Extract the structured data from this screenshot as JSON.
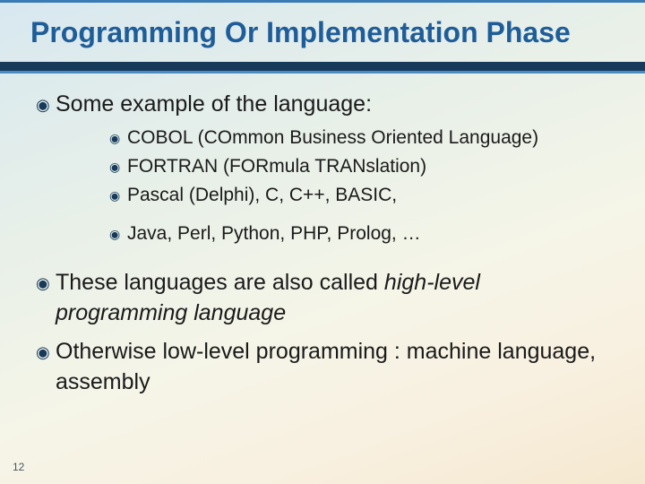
{
  "slide": {
    "title": "Programming Or Implementation Phase",
    "page_number": "12",
    "bullet_glyph_lvl1": "◉",
    "bullet_glyph_lvl2": "◉",
    "points": [
      {
        "text": "Some example of the language:",
        "sub": [
          "COBOL (COmmon Business Oriented Language)",
          "FORTRAN (FORmula TRANslation)",
          "Pascal (Delphi),  C,  C++, BASIC,"
        ],
        "sub_after_gap": [
          "Java, Perl, Python, PHP, Prolog, …"
        ]
      },
      {
        "text_pre": "These languages are also called ",
        "text_italic": "high-level programming language",
        "text_post": ""
      },
      {
        "text": "Otherwise low-level programming : machine language, assembly"
      }
    ]
  }
}
